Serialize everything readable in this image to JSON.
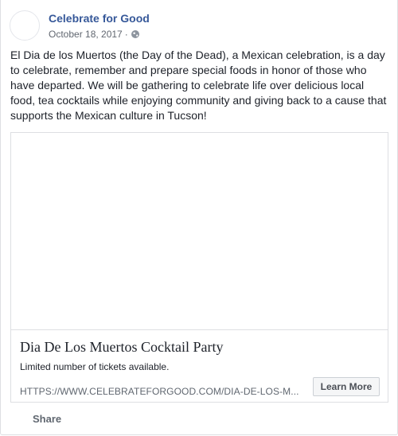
{
  "post": {
    "page_name": "Celebrate for Good",
    "date": "October 18, 2017",
    "separator": "·",
    "privacy_icon": "globe-icon",
    "text": "El Dia de los Muertos (the Day of the Dead), a Mexican celebration, is a day to celebrate, remember and prepare special foods in honor of those who have departed. We will be gathering to celebrate life over delicious local food, tea cocktails while enjoying community and giving back to a cause that supports the Mexican culture in Tucson!"
  },
  "link_card": {
    "title": "Dia De Los Muertos Cocktail Party",
    "description": "Limited number of tickets available.",
    "url": "HTTPS://WWW.CELEBRATEFORGOOD.COM/DIA-DE-LOS-M...",
    "button_label": "Learn More"
  },
  "actions": {
    "share_label": "Share"
  },
  "colors": {
    "link_blue": "#365899",
    "accent_blue": "#4080ff",
    "border": "#dddfe2",
    "muted_text": "#616770"
  }
}
